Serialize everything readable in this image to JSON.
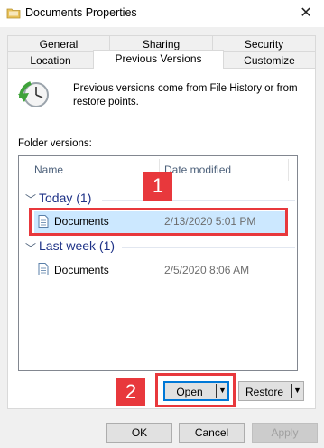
{
  "window": {
    "title": "Documents Properties",
    "close_glyph": "✕"
  },
  "tabs_row1": [
    "General",
    "Sharing",
    "Security"
  ],
  "tabs_row2": [
    "Location",
    "Previous Versions",
    "Customize"
  ],
  "info_text": "Previous versions come from File History or from restore points.",
  "folder_versions_label": "Folder versions:",
  "columns": {
    "name": "Name",
    "date_modified": "Date modified"
  },
  "groups": [
    {
      "label": "Today (1)",
      "items": [
        {
          "name": "Documents",
          "date": "2/13/2020 5:01 PM",
          "selected": true
        }
      ]
    },
    {
      "label": "Last week (1)",
      "items": [
        {
          "name": "Documents",
          "date": "2/5/2020 8:06 AM",
          "selected": false
        }
      ]
    }
  ],
  "callouts": {
    "one": "1",
    "two": "2"
  },
  "buttons": {
    "open": "Open",
    "restore": "Restore",
    "ok": "OK",
    "cancel": "Cancel",
    "apply": "Apply"
  },
  "colors": {
    "highlight": "#e8383c",
    "selection": "#cce8ff",
    "group_text": "#1e3287"
  }
}
